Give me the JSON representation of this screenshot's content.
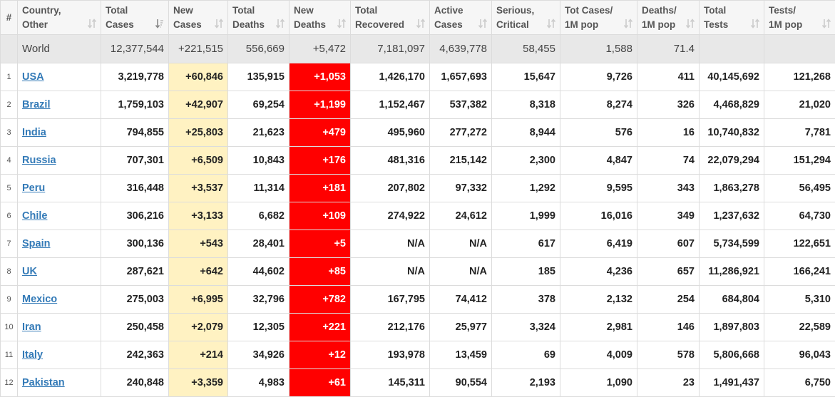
{
  "table": {
    "headers": [
      {
        "key": "rank",
        "lines": [
          "#"
        ],
        "sort_icon": ""
      },
      {
        "key": "country",
        "lines": [
          "Country,",
          "Other"
        ],
        "sort_icon": "sort-both-icon"
      },
      {
        "key": "total_cases",
        "lines": [
          "Total",
          "Cases"
        ],
        "sort_icon": "sort-active-desc-icon"
      },
      {
        "key": "new_cases",
        "lines": [
          "New",
          "Cases"
        ],
        "sort_icon": "sort-both-icon"
      },
      {
        "key": "total_deaths",
        "lines": [
          "Total",
          "Deaths"
        ],
        "sort_icon": "sort-both-icon"
      },
      {
        "key": "new_deaths",
        "lines": [
          "New",
          "Deaths"
        ],
        "sort_icon": "sort-both-icon"
      },
      {
        "key": "total_recovered",
        "lines": [
          "Total",
          "Recovered"
        ],
        "sort_icon": "sort-both-icon"
      },
      {
        "key": "active_cases",
        "lines": [
          "Active",
          "Cases"
        ],
        "sort_icon": "sort-both-icon"
      },
      {
        "key": "serious",
        "lines": [
          "Serious,",
          "Critical"
        ],
        "sort_icon": "sort-both-icon"
      },
      {
        "key": "cases_per_m",
        "lines": [
          "Tot Cases/",
          "1M pop"
        ],
        "sort_icon": "sort-both-icon"
      },
      {
        "key": "deaths_per_m",
        "lines": [
          "Deaths/",
          "1M pop"
        ],
        "sort_icon": "sort-both-icon"
      },
      {
        "key": "total_tests",
        "lines": [
          "Total",
          "Tests"
        ],
        "sort_icon": "sort-both-icon"
      },
      {
        "key": "tests_per_m",
        "lines": [
          "Tests/",
          "1M pop"
        ],
        "sort_icon": "sort-both-icon"
      }
    ],
    "world": [
      "",
      "World",
      "12,377,544",
      "+221,515",
      "556,669",
      "+5,472",
      "7,181,097",
      "4,639,778",
      "58,455",
      "1,588",
      "71.4",
      "",
      ""
    ],
    "rows": [
      [
        "1",
        "USA",
        "3,219,778",
        "+60,846",
        "135,915",
        "+1,053",
        "1,426,170",
        "1,657,693",
        "15,647",
        "9,726",
        "411",
        "40,145,692",
        "121,268"
      ],
      [
        "2",
        "Brazil",
        "1,759,103",
        "+42,907",
        "69,254",
        "+1,199",
        "1,152,467",
        "537,382",
        "8,318",
        "8,274",
        "326",
        "4,468,829",
        "21,020"
      ],
      [
        "3",
        "India",
        "794,855",
        "+25,803",
        "21,623",
        "+479",
        "495,960",
        "277,272",
        "8,944",
        "576",
        "16",
        "10,740,832",
        "7,781"
      ],
      [
        "4",
        "Russia",
        "707,301",
        "+6,509",
        "10,843",
        "+176",
        "481,316",
        "215,142",
        "2,300",
        "4,847",
        "74",
        "22,079,294",
        "151,294"
      ],
      [
        "5",
        "Peru",
        "316,448",
        "+3,537",
        "11,314",
        "+181",
        "207,802",
        "97,332",
        "1,292",
        "9,595",
        "343",
        "1,863,278",
        "56,495"
      ],
      [
        "6",
        "Chile",
        "306,216",
        "+3,133",
        "6,682",
        "+109",
        "274,922",
        "24,612",
        "1,999",
        "16,016",
        "349",
        "1,237,632",
        "64,730"
      ],
      [
        "7",
        "Spain",
        "300,136",
        "+543",
        "28,401",
        "+5",
        "N/A",
        "N/A",
        "617",
        "6,419",
        "607",
        "5,734,599",
        "122,651"
      ],
      [
        "8",
        "UK",
        "287,621",
        "+642",
        "44,602",
        "+85",
        "N/A",
        "N/A",
        "185",
        "4,236",
        "657",
        "11,286,921",
        "166,241"
      ],
      [
        "9",
        "Mexico",
        "275,003",
        "+6,995",
        "32,796",
        "+782",
        "167,795",
        "74,412",
        "378",
        "2,132",
        "254",
        "684,804",
        "5,310"
      ],
      [
        "10",
        "Iran",
        "250,458",
        "+2,079",
        "12,305",
        "+221",
        "212,176",
        "25,977",
        "3,324",
        "2,981",
        "146",
        "1,897,803",
        "22,589"
      ],
      [
        "11",
        "Italy",
        "242,363",
        "+214",
        "34,926",
        "+12",
        "193,978",
        "13,459",
        "69",
        "4,009",
        "578",
        "5,806,668",
        "96,043"
      ],
      [
        "12",
        "Pakistan",
        "240,848",
        "+3,359",
        "4,983",
        "+61",
        "145,311",
        "90,554",
        "2,193",
        "1,090",
        "23",
        "1,491,437",
        "6,750"
      ]
    ]
  },
  "colors": {
    "new_cases_bg": "#fff2c2",
    "new_deaths_bg": "#ff0000",
    "world_row_bg": "#e8e8e8",
    "header_bg": "#f6f6f6",
    "link": "#337ab7"
  }
}
